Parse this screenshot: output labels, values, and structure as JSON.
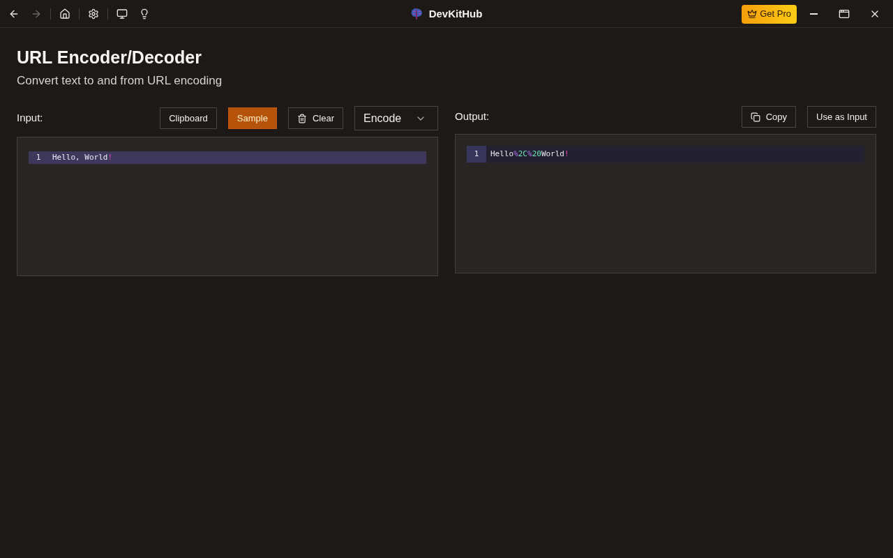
{
  "titlebar": {
    "back": {
      "disabled": false
    },
    "forward": {
      "disabled": true
    },
    "app_name": "DevKitHub",
    "get_pro": "Get Pro"
  },
  "page": {
    "title": "URL Encoder/Decoder",
    "subtitle": "Convert text to and from URL encoding"
  },
  "input_panel": {
    "label": "Input:",
    "buttons": [
      {
        "label": "Clipboard",
        "kind": "outline"
      },
      {
        "label": "Sample",
        "kind": "accent"
      },
      {
        "label": "Clear",
        "kind": "clear"
      }
    ],
    "mode_select": {
      "value": "Encode"
    },
    "editor": {
      "lines": [
        {
          "number": "1",
          "active": true,
          "tokens": [
            {
              "text": "Hello, World",
              "kind": "text"
            },
            {
              "text": "!",
              "kind": "punct"
            }
          ]
        }
      ]
    }
  },
  "output_panel": {
    "label": "Output:",
    "buttons": [
      {
        "label": "Copy",
        "kind": "copy"
      },
      {
        "label": "Use as Input",
        "kind": "outline"
      }
    ],
    "editor": {
      "lines": [
        {
          "number": "1",
          "active": false,
          "tokens": [
            {
              "text": "Hello",
              "kind": "text"
            },
            {
              "text": "%",
              "kind": "percent"
            },
            {
              "text": "2C",
              "kind": "hex"
            },
            {
              "text": "%",
              "kind": "percent"
            },
            {
              "text": "20",
              "kind": "hex"
            },
            {
              "text": "World",
              "kind": "text"
            },
            {
              "text": "!",
              "kind": "punct"
            }
          ]
        }
      ]
    }
  }
}
